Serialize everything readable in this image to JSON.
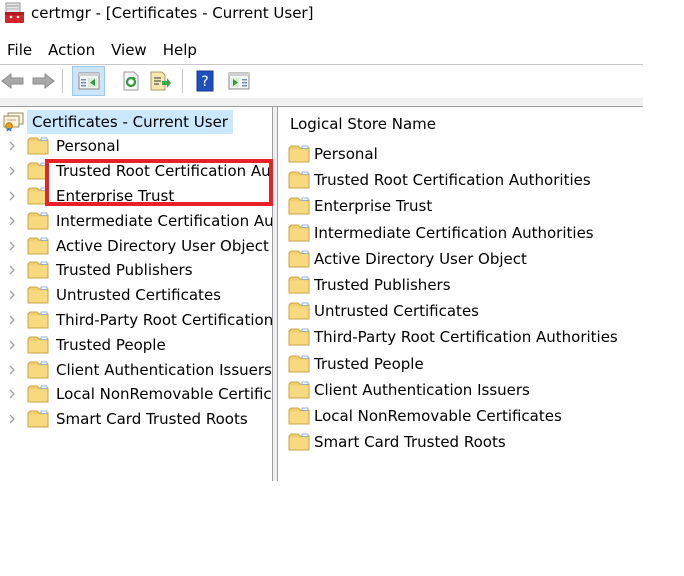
{
  "window": {
    "title": "certmgr - [Certificates - Current User]",
    "app_icon": "certmgr-toolbox-icon"
  },
  "menu": {
    "items": [
      {
        "label": "File"
      },
      {
        "label": "Action"
      },
      {
        "label": "View"
      },
      {
        "label": "Help"
      }
    ]
  },
  "toolbar": {
    "buttons": [
      {
        "name": "back-button",
        "icon": "back-arrow-icon",
        "enabled": false
      },
      {
        "name": "forward-button",
        "icon": "forward-arrow-icon",
        "enabled": false
      },
      {
        "name": "show-hide-console-tree-button",
        "icon": "console-tree-icon",
        "active": true
      },
      {
        "name": "refresh-button",
        "icon": "refresh-icon"
      },
      {
        "name": "export-list-button",
        "icon": "export-list-icon"
      },
      {
        "name": "help-button",
        "icon": "help-icon"
      },
      {
        "name": "show-hide-action-pane-button",
        "icon": "action-pane-icon"
      }
    ]
  },
  "tree": {
    "root": {
      "label": "Certificates - Current User",
      "icon": "certificates-icon",
      "selected": true
    },
    "items": [
      {
        "label": "Personal"
      },
      {
        "label": "Trusted Root Certification Authorities"
      },
      {
        "label": "Enterprise Trust"
      },
      {
        "label": "Intermediate Certification Authorities"
      },
      {
        "label": "Active Directory User Object"
      },
      {
        "label": "Trusted Publishers"
      },
      {
        "label": "Untrusted Certificates"
      },
      {
        "label": "Third-Party Root Certification Authorities"
      },
      {
        "label": "Trusted People"
      },
      {
        "label": "Client Authentication Issuers"
      },
      {
        "label": "Local NonRemovable Certificates"
      },
      {
        "label": "Smart Card Trusted Roots"
      }
    ]
  },
  "list": {
    "column_header": "Logical Store Name",
    "items": [
      {
        "label": "Personal"
      },
      {
        "label": "Trusted Root Certification Authorities"
      },
      {
        "label": "Enterprise Trust"
      },
      {
        "label": "Intermediate Certification Authorities"
      },
      {
        "label": "Active Directory User Object"
      },
      {
        "label": "Trusted Publishers"
      },
      {
        "label": "Untrusted Certificates"
      },
      {
        "label": "Third-Party Root Certification Authorities"
      },
      {
        "label": "Trusted People"
      },
      {
        "label": "Client Authentication Issuers"
      },
      {
        "label": "Local NonRemovable Certificates"
      },
      {
        "label": "Smart Card Trusted Roots"
      }
    ]
  },
  "annotation": {
    "type": "highlight-rectangle",
    "color": "#e8202a",
    "covers": [
      "Trusted Root Certification Authorities",
      "Enterprise Trust"
    ]
  },
  "colors": {
    "selection": "#cce8ff",
    "toolbar_active": "#cce4f7",
    "folder": "#f2cf6e",
    "highlight": "#e8202a"
  }
}
